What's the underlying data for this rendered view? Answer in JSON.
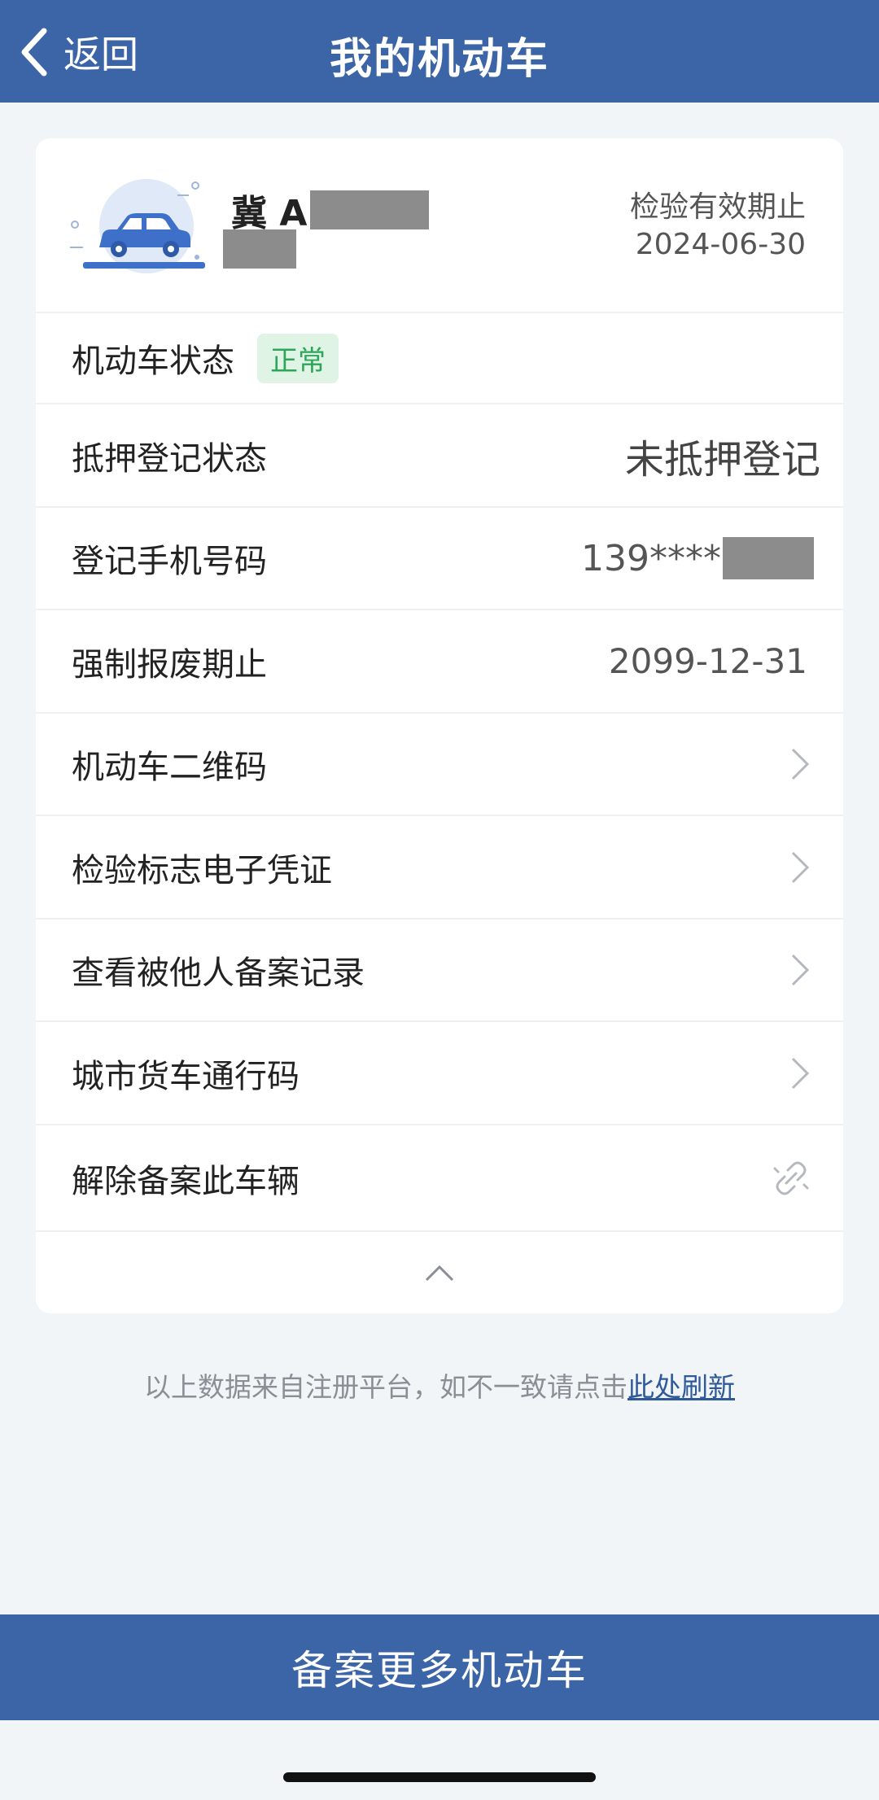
{
  "topbar": {
    "back_label": "返回",
    "title": "我的机动车"
  },
  "vehicle": {
    "plate_prefix": "冀 A",
    "inspection_label": "检验有效期止",
    "inspection_date": "2024-06-30"
  },
  "rows": {
    "status": {
      "label": "机动车状态",
      "badge": "正常"
    },
    "mortgage": {
      "label": "抵押登记状态",
      "value": "未抵押登记"
    },
    "phone": {
      "label": "登记手机号码",
      "value": "139****"
    },
    "scrap": {
      "label": "强制报废期止",
      "value": "2099-12-31"
    },
    "qr": {
      "label": "机动车二维码"
    },
    "inspection_cert": {
      "label": "检验标志电子凭证"
    },
    "records": {
      "label": "查看被他人备案记录"
    },
    "truck_pass": {
      "label": "城市货车通行码"
    },
    "unbind": {
      "label": "解除备案此车辆"
    }
  },
  "footnote": {
    "text": "以上数据来自注册平台，如不一致请点击",
    "link": "此处刷新"
  },
  "bottom_button": {
    "label": "备案更多机动车"
  },
  "colors": {
    "brand_blue": "#3b65a6",
    "status_green": "#2da659",
    "status_green_bg": "#dff4e5",
    "link_blue": "#2e5a9c"
  },
  "icons": {
    "back": "chevron-left-icon",
    "row_arrow": "chevron-right-icon",
    "unbind": "unlink-icon",
    "collapse": "chevron-up-icon",
    "vehicle": "car-icon"
  }
}
